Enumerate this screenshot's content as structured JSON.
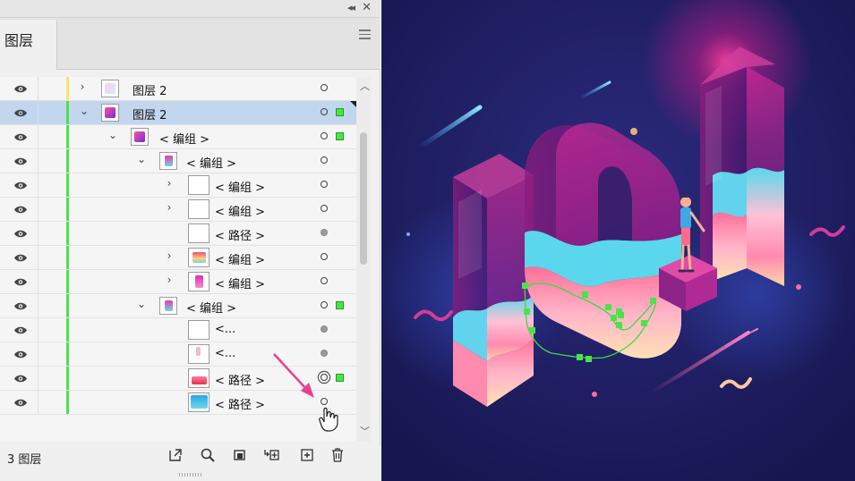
{
  "panel": {
    "tab_label": "图层",
    "layer_count_label": "3 图层"
  },
  "icons": {
    "titlebar": [
      "collapse-icon",
      "close-icon"
    ],
    "row": [
      "eye-icon",
      "chevron-icon",
      "layer-thumbnail",
      "target-circle-icon",
      "selection-square"
    ],
    "footer": [
      "export-icon",
      "search-icon",
      "clipping-mask-icon",
      "new-sublayer-icon",
      "new-layer-icon",
      "trash-icon"
    ]
  },
  "colors": {
    "selected_row": "#c2d6ee",
    "layer_bar_green": "#4be34b",
    "layer_bar_yellow": "#f7e46a",
    "artwork_background": "#1b1a55",
    "annotation_arrow": "#ea3f8c"
  },
  "layers": [
    {
      "name": "图层 2",
      "chevron": "›",
      "selected": false
    },
    {
      "name": "图层 2",
      "chevron": "⌄",
      "selected": true
    },
    {
      "name": "< 编组 >",
      "chevron": "⌄",
      "selected": false
    },
    {
      "name": "< 编组 >",
      "chevron": "⌄",
      "selected": false
    },
    {
      "name": "< 编组 >",
      "chevron": "›",
      "selected": false
    },
    {
      "name": "< 编组 >",
      "chevron": "›",
      "selected": false
    },
    {
      "name": "< 路径 >",
      "chevron": "",
      "selected": false
    },
    {
      "name": "< 编组 >",
      "chevron": "›",
      "selected": false
    },
    {
      "name": "< 编组 >",
      "chevron": "›",
      "selected": false
    },
    {
      "name": "< 编组 >",
      "chevron": "⌄",
      "selected": false
    },
    {
      "name": "<...",
      "chevron": "",
      "selected": false
    },
    {
      "name": "<...",
      "chevron": "",
      "selected": false
    },
    {
      "name": "< 路径 >",
      "chevron": "",
      "selected": false
    },
    {
      "name": "< 路径 >",
      "chevron": "",
      "selected": false
    }
  ]
}
